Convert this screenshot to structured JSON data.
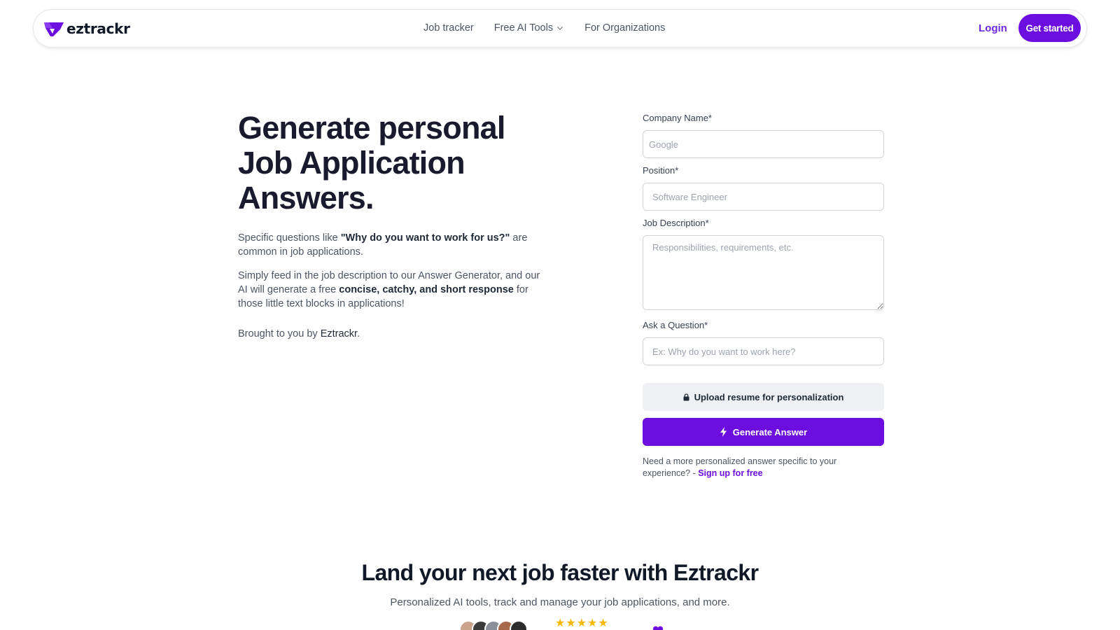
{
  "header": {
    "logo_text": "eztrackr",
    "nav": [
      {
        "label": "Job tracker"
      },
      {
        "label": "Free AI Tools"
      },
      {
        "label": "For Organizations"
      }
    ],
    "login_label": "Login",
    "cta_label": "Get started"
  },
  "hero": {
    "title": "Generate personal Job Application Answers.",
    "p1_before": "Specific questions like ",
    "p1_bold": "\"Why do you want to work for us?\"",
    "p1_after": " are common in job applications.",
    "p2_before": "Simply feed in the job description to our Answer Generator, and our AI will generate a free ",
    "p2_bold": "concise, catchy, and short response",
    "p2_after": " for those little text blocks in applications!",
    "p3_before": "Brought to you by ",
    "p3_bold": "Eztrackr",
    "p3_after": "."
  },
  "form": {
    "company_label": "Company Name*",
    "company_placeholder": "Google",
    "position_label": "Position*",
    "position_placeholder": "Software Engineer",
    "description_label": "Job Description*",
    "description_placeholder": "Responsibilities, requirements, etc.",
    "question_label": "Ask a Question*",
    "question_placeholder": "Ex: Why do you want to work here?",
    "upload_label": "Upload resume for personalization",
    "generate_label": "Generate Answer",
    "note_text": "Need a more personalized answer specific to your experience? - ",
    "note_link": "Sign up for free"
  },
  "bottom": {
    "title": "Land your next job faster with Eztrackr",
    "subtitle": "Personalized AI tools, track and manage your job applications, and more.",
    "rating_stars": 5
  },
  "colors": {
    "brand": "#6d0ee0",
    "star": "#f5b800"
  }
}
